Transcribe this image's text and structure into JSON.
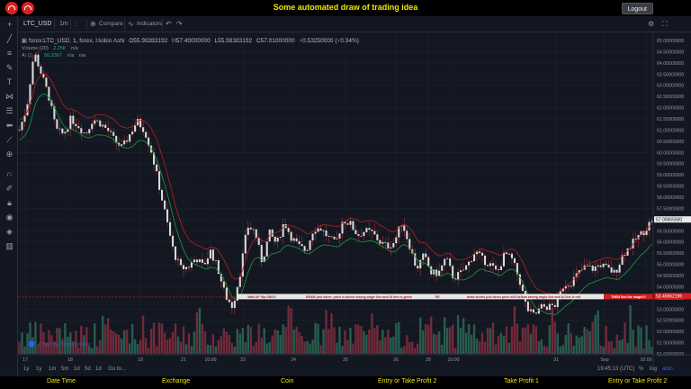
{
  "header": {
    "title": "Some automated draw of trading idea",
    "logout_label": "Logout"
  },
  "toolbar": {
    "symbol": "LTC_USD",
    "timeframe": "1m",
    "compare_label": "Compare",
    "indicators_label": "Indicators"
  },
  "legend": {
    "main": "forex:LTC_USD, 1, forex, Heikin Ashi",
    "open": "O55.98383192",
    "high": "H57.49000000",
    "low": "L55.98383192",
    "close": "C57.01000000",
    "change": "+0.53250000 (+0.94%)",
    "volume_label": "Volume (20)",
    "volume_value": "2.25K",
    "volume_na": "n/a",
    "ai_label": "AI (1, 1)",
    "ai_value": "56.2367",
    "ai_na1": "n/a",
    "ai_na2": "n/a"
  },
  "annotations": {
    "wait": "Wait UP flip ONDO",
    "draw1": "DRAW just when: price is above strong angle line and AI line is green",
    "sr": "SR",
    "draw2": "draw shorts just when price still bellow strong angle line and AI line is red",
    "then": "THEN See the magic!!!",
    "current_price": "53.45662196",
    "last_price": "57.00665500"
  },
  "watermark": "Chart by TradingView",
  "bottom": {
    "ranges": [
      "1y",
      "1y",
      "1m",
      "5m",
      "1d",
      "5d",
      "1d"
    ],
    "goto": "Go to...",
    "time": "19:45:13 (UTC)",
    "pct": "%",
    "log": "log",
    "auto": "auto"
  },
  "footer": {
    "items": [
      "Date Time",
      "Exchange",
      "Coin",
      "Entry or Take Profit 2",
      "Take Profit 1",
      "Entry or Take Profit 2"
    ]
  },
  "colors": {
    "accent_yellow": "#f2e600",
    "candle_body": "#d9d9d9",
    "candle_wick": "#a83030",
    "ai_line_green": "#1e9a3a",
    "ai_line_red": "#b82020",
    "vol_up": "#2e6e5a",
    "vol_down": "#8a3040",
    "annot_red": "#d32020"
  },
  "chart_data": {
    "type": "candlestick",
    "y_ticks": [
      "65.00000000",
      "64.50000000",
      "64.00000000",
      "63.50000000",
      "63.00000000",
      "62.50000000",
      "62.00000000",
      "61.50000000",
      "61.00000000",
      "60.50000000",
      "60.00000000",
      "59.50000000",
      "59.00000000",
      "58.50000000",
      "58.00000000",
      "57.50000000",
      "57.00000000",
      "56.50000000",
      "56.00000000",
      "55.50000000",
      "55.00000000",
      "54.50000000",
      "54.00000000",
      "53.50000000",
      "53.00000000",
      "52.50000000",
      "52.00000000",
      "51.50000000",
      "51.00000000"
    ],
    "x_ticks": [
      "17",
      "18",
      "19",
      "21",
      "10:00",
      "23",
      "24",
      "25",
      "26",
      "28",
      "10:00",
      "31",
      "Sep",
      "10:00"
    ],
    "ylim": [
      51.0,
      65.2
    ],
    "close_path": [
      61.0,
      62.0,
      64.5,
      63.5,
      62.5,
      61.0,
      60.8,
      61.5,
      61.2,
      60.8,
      61.5,
      61.3,
      61.0,
      60.5,
      60.2,
      60.8,
      61.4,
      61.0,
      60.0,
      58.5,
      57.0,
      55.5,
      54.8,
      54.9,
      55.3,
      54.9,
      55.6,
      54.8,
      53.6,
      53.1,
      54.6,
      56.7,
      56.5,
      55.1,
      56.4,
      55.9,
      56.9,
      56.2,
      55.8,
      55.6,
      56.6,
      56.6,
      56.2,
      55.9,
      57.0,
      56.8,
      56.3,
      56.5,
      56.4,
      56.0,
      55.8,
      56.0,
      56.9,
      55.9,
      54.8,
      55.4,
      54.6,
      54.6,
      55.3,
      54.4,
      54.6,
      55.0,
      55.6,
      55.2,
      55.0,
      54.6,
      55.5,
      55.2,
      54.3,
      53.0,
      52.7,
      53.1,
      53.1,
      53.2,
      54.1,
      54.2,
      54.6,
      54.9,
      54.8,
      55.0,
      54.8,
      54.6,
      55.4,
      55.8,
      56.2,
      56.5,
      57.0
    ]
  }
}
